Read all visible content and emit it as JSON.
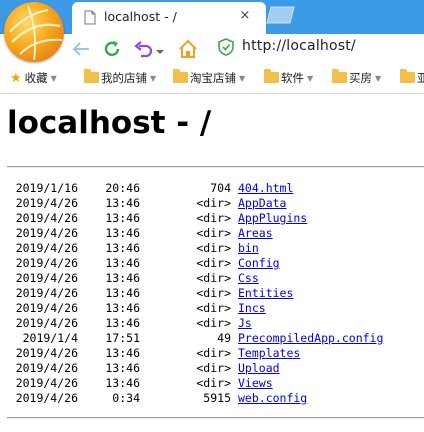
{
  "browser": {
    "tab": {
      "title": "localhost - /",
      "close_glyph": "×"
    },
    "address_bar": {
      "url": "http://localhost/"
    },
    "bookmarks": [
      {
        "label": "收藏",
        "icon": "star-icon"
      },
      {
        "label": "我的店铺",
        "icon": "folder-icon"
      },
      {
        "label": "淘宝店铺",
        "icon": "folder-icon"
      },
      {
        "label": "软件",
        "icon": "folder-icon"
      },
      {
        "label": "买房",
        "icon": "folder-icon"
      },
      {
        "label": "亚",
        "icon": "folder-icon"
      }
    ]
  },
  "page": {
    "title": "localhost - /",
    "entries": [
      {
        "date": "2019/1/16",
        "time": "20:46",
        "size": "704",
        "name": "404.html"
      },
      {
        "date": "2019/4/26",
        "time": "13:46",
        "size": "<dir>",
        "name": "AppData"
      },
      {
        "date": "2019/4/26",
        "time": "13:46",
        "size": "<dir>",
        "name": "AppPlugins"
      },
      {
        "date": "2019/4/26",
        "time": "13:46",
        "size": "<dir>",
        "name": "Areas"
      },
      {
        "date": "2019/4/26",
        "time": "13:46",
        "size": "<dir>",
        "name": "bin"
      },
      {
        "date": "2019/4/26",
        "time": "13:46",
        "size": "<dir>",
        "name": "Config"
      },
      {
        "date": "2019/4/26",
        "time": "13:46",
        "size": "<dir>",
        "name": "Css"
      },
      {
        "date": "2019/4/26",
        "time": "13:46",
        "size": "<dir>",
        "name": "Entities"
      },
      {
        "date": "2019/4/26",
        "time": "13:46",
        "size": "<dir>",
        "name": "Incs"
      },
      {
        "date": "2019/4/26",
        "time": "13:46",
        "size": "<dir>",
        "name": "Js"
      },
      {
        "date": "2019/1/4",
        "time": "17:51",
        "size": "49",
        "name": "PrecompiledApp.config"
      },
      {
        "date": "2019/4/26",
        "time": "13:46",
        "size": "<dir>",
        "name": "Templates"
      },
      {
        "date": "2019/4/26",
        "time": "13:46",
        "size": "<dir>",
        "name": "Upload"
      },
      {
        "date": "2019/4/26",
        "time": "13:46",
        "size": "<dir>",
        "name": "Views"
      },
      {
        "date": "2019/4/26",
        "time": "0:34",
        "size": "5915",
        "name": "web.config"
      }
    ]
  },
  "colors": {
    "tabstrip": "#3d9ae6",
    "link": "#0000ee",
    "back_arrow": "#9ac5f0",
    "refresh": "#2fa84f",
    "undo": "#8a4fd0",
    "home": "#f0a020",
    "shield": "#3aa84a"
  }
}
